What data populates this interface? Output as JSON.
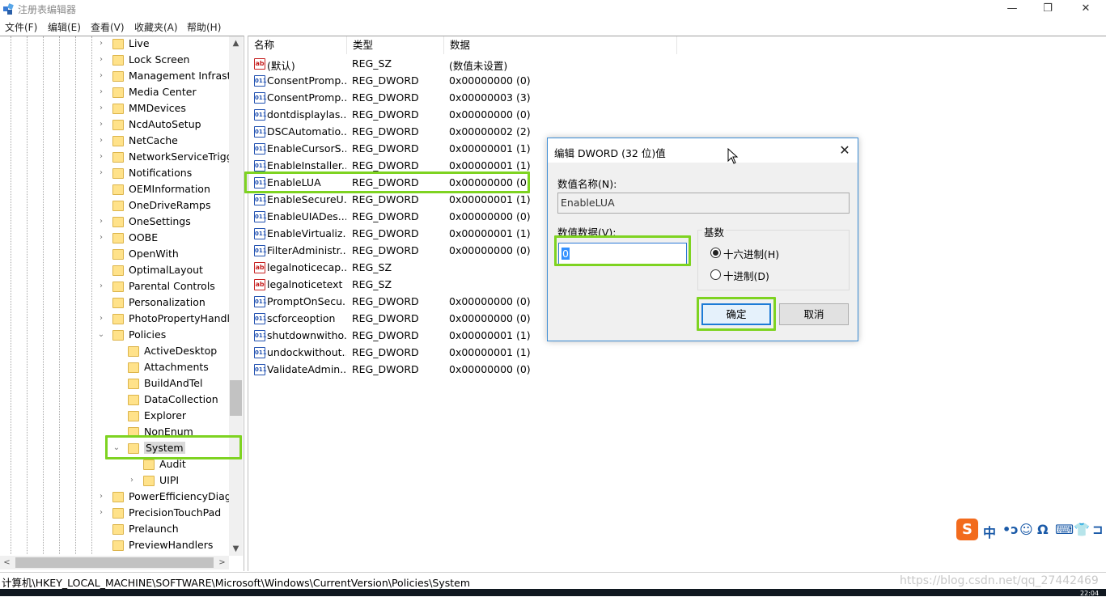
{
  "window": {
    "title": "注册表编辑器",
    "min_glyph": "—",
    "max_glyph": "❐",
    "close_glyph": "✕"
  },
  "menu": [
    "文件(F)",
    "编辑(E)",
    "查看(V)",
    "收藏夹(A)",
    "帮助(H)"
  ],
  "tree": {
    "items": [
      {
        "label": "Live",
        "arrow": "›"
      },
      {
        "label": "Lock Screen",
        "arrow": "›"
      },
      {
        "label": "Management Infrastr",
        "arrow": "›"
      },
      {
        "label": "Media Center",
        "arrow": "›"
      },
      {
        "label": "MMDevices",
        "arrow": "›"
      },
      {
        "label": "NcdAutoSetup",
        "arrow": "›"
      },
      {
        "label": "NetCache",
        "arrow": "›"
      },
      {
        "label": "NetworkServiceTrigge",
        "arrow": "›"
      },
      {
        "label": "Notifications",
        "arrow": "›"
      },
      {
        "label": "OEMInformation",
        "arrow": ""
      },
      {
        "label": "OneDriveRamps",
        "arrow": ""
      },
      {
        "label": "OneSettings",
        "arrow": "›"
      },
      {
        "label": "OOBE",
        "arrow": "›"
      },
      {
        "label": "OpenWith",
        "arrow": ""
      },
      {
        "label": "OptimalLayout",
        "arrow": ""
      },
      {
        "label": "Parental Controls",
        "arrow": "›"
      },
      {
        "label": "Personalization",
        "arrow": ""
      },
      {
        "label": "PhotoPropertyHandle",
        "arrow": "›"
      },
      {
        "label": "Policies",
        "arrow": "⌄"
      },
      {
        "label": "ActiveDesktop",
        "arrow": ""
      },
      {
        "label": "Attachments",
        "arrow": ""
      },
      {
        "label": "BuildAndTel",
        "arrow": ""
      },
      {
        "label": "DataCollection",
        "arrow": ""
      },
      {
        "label": "Explorer",
        "arrow": ""
      },
      {
        "label": "NonEnum",
        "arrow": ""
      },
      {
        "label": "System",
        "arrow": "⌄"
      },
      {
        "label": "Audit",
        "arrow": ""
      },
      {
        "label": "UIPI",
        "arrow": "›"
      },
      {
        "label": "PowerEfficiencyDiagn",
        "arrow": "›"
      },
      {
        "label": "PrecisionTouchPad",
        "arrow": "›"
      },
      {
        "label": "Prelaunch",
        "arrow": ""
      },
      {
        "label": "PreviewHandlers",
        "arrow": ""
      }
    ],
    "scroll_up": "▲",
    "scroll_down": "▼",
    "scroll_left": "<",
    "scroll_right": ">"
  },
  "list": {
    "headers": {
      "name": "名称",
      "type": "类型",
      "data": "数据"
    },
    "rows": [
      {
        "icon": "ab",
        "name": "(默认)",
        "type": "REG_SZ",
        "data": "(数值未设置)"
      },
      {
        "icon": "011",
        "name": "ConsentPromp...",
        "type": "REG_DWORD",
        "data": "0x00000000 (0)"
      },
      {
        "icon": "011",
        "name": "ConsentPromp...",
        "type": "REG_DWORD",
        "data": "0x00000003 (3)"
      },
      {
        "icon": "011",
        "name": "dontdisplaylas...",
        "type": "REG_DWORD",
        "data": "0x00000000 (0)"
      },
      {
        "icon": "011",
        "name": "DSCAutomatio...",
        "type": "REG_DWORD",
        "data": "0x00000002 (2)"
      },
      {
        "icon": "011",
        "name": "EnableCursorS...",
        "type": "REG_DWORD",
        "data": "0x00000001 (1)"
      },
      {
        "icon": "011",
        "name": "EnableInstaller...",
        "type": "REG_DWORD",
        "data": "0x00000001 (1)"
      },
      {
        "icon": "011",
        "name": "EnableLUA",
        "type": "REG_DWORD",
        "data": "0x00000000 (0)"
      },
      {
        "icon": "011",
        "name": "EnableSecureU...",
        "type": "REG_DWORD",
        "data": "0x00000001 (1)"
      },
      {
        "icon": "011",
        "name": "EnableUIADes...",
        "type": "REG_DWORD",
        "data": "0x00000000 (0)"
      },
      {
        "icon": "011",
        "name": "EnableVirtualiz...",
        "type": "REG_DWORD",
        "data": "0x00000001 (1)"
      },
      {
        "icon": "011",
        "name": "FilterAdministr...",
        "type": "REG_DWORD",
        "data": "0x00000000 (0)"
      },
      {
        "icon": "ab",
        "name": "legalnoticecap...",
        "type": "REG_SZ",
        "data": ""
      },
      {
        "icon": "ab",
        "name": "legalnoticetext",
        "type": "REG_SZ",
        "data": ""
      },
      {
        "icon": "011",
        "name": "PromptOnSecu...",
        "type": "REG_DWORD",
        "data": "0x00000000 (0)"
      },
      {
        "icon": "011",
        "name": "scforceoption",
        "type": "REG_DWORD",
        "data": "0x00000000 (0)"
      },
      {
        "icon": "011",
        "name": "shutdownwitho...",
        "type": "REG_DWORD",
        "data": "0x00000001 (1)"
      },
      {
        "icon": "011",
        "name": "undockwithout...",
        "type": "REG_DWORD",
        "data": "0x00000001 (1)"
      },
      {
        "icon": "011",
        "name": "ValidateAdmin...",
        "type": "REG_DWORD",
        "data": "0x00000000 (0)"
      }
    ]
  },
  "dialog": {
    "title": "编辑 DWORD (32 位)值",
    "close_glyph": "✕",
    "name_label": "数值名称(N):",
    "name_value": "EnableLUA",
    "data_label": "数值数据(V):",
    "data_value": "0",
    "base_label": "基数",
    "hex_label": "十六进制(H)",
    "dec_label": "十进制(D)",
    "hex_selected": true,
    "ok_label": "确定",
    "cancel_label": "取消"
  },
  "status": {
    "path": "计算机\\HKEY_LOCAL_MACHINE\\SOFTWARE\\Microsoft\\Windows\\CurrentVersion\\Policies\\System",
    "watermark": "https://blog.csdn.net/qq_27442469",
    "clock": "22:04"
  },
  "ime": {
    "logo": "S",
    "items": [
      "中",
      "•ɔ",
      "☺",
      "Ω",
      "⌨",
      "👕",
      "⊐"
    ]
  },
  "colors": {
    "highlight": "#7ed321",
    "dialog_border": "#3b8cd4",
    "selection": "#3390ff",
    "sogou": "#f26b1d"
  }
}
